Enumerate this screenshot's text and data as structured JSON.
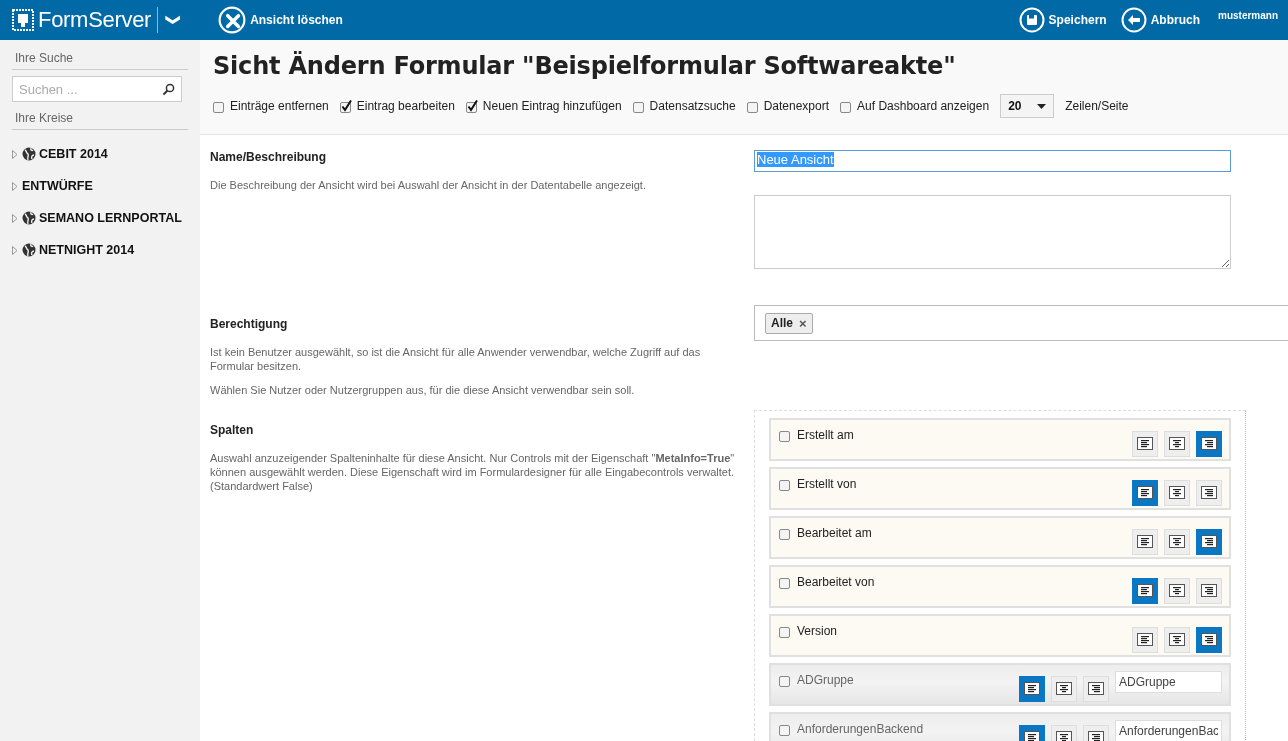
{
  "topbar": {
    "logo": "FormServer",
    "caret": "❯",
    "actions": [
      {
        "kind": "delete",
        "label": "Ansicht löschen"
      }
    ],
    "right_actions": [
      {
        "kind": "save",
        "label": "Speichern"
      },
      {
        "kind": "cancel",
        "label": "Abbruch"
      }
    ],
    "user": "mustermann"
  },
  "sidebar": {
    "search_heading": "Ihre Suche",
    "search": {
      "placeholder": "Suchen ..."
    },
    "circles_heading": "Ihre Kreise",
    "items": [
      {
        "label": "CEBIT 2014",
        "kind": "public",
        "expanded": false
      },
      {
        "label": "ENTWÜRFE",
        "kind": "folder",
        "expanded": false
      },
      {
        "label": "SEMANO LERNPORTAL",
        "kind": "public",
        "expanded": false
      },
      {
        "label": "NETNIGHT 2014",
        "kind": "public",
        "expanded": false
      }
    ]
  },
  "page": {
    "title": "Sicht Ändern Formular \"Beispielformular Softwareakte\"",
    "options": [
      {
        "label": "Einträge entfernen",
        "checked": false
      },
      {
        "label": "Eintrag bearbeiten",
        "checked": true
      },
      {
        "label": "Neuen Eintrag hinzufügen",
        "checked": true
      },
      {
        "label": "Datensatzsuche",
        "checked": false
      },
      {
        "label": "Datenexport",
        "checked": false
      },
      {
        "label": "Auf Dashboard anzeigen",
        "checked": false
      }
    ],
    "rows_per_page": {
      "value": "20",
      "label": "Zeilen/Seite"
    }
  },
  "sections": [
    {
      "kind": "name",
      "heading": "Name/Beschreibung",
      "texts": [
        "Die Beschreibung der Ansicht wird bei Auswahl der Ansicht in der Datentabelle angezeigt."
      ],
      "name_value": "Neue Ansicht"
    },
    {
      "kind": "permission",
      "heading": "Berechtigung",
      "texts": [
        "Ist kein Benutzer ausgewählt, so ist die Ansicht für alle Anwender verwendbar, welche Zugriff auf das Formular besitzen.",
        "Wählen Sie Nutzer oder Nutzergruppen aus, für die diese Ansicht verwendbar sein soll."
      ],
      "tags": [
        {
          "label": "Alle",
          "remove": "×"
        }
      ]
    },
    {
      "kind": "columns",
      "heading": "Spalten",
      "texts": [
        "Auswahl anzuzeigender Spalteninhalte für diese Ansicht. Nur Controls mit der Eigenschaft \"**MetaInfo=True**\" können ausgewählt werden. Diese Eigenschaft wird im Formulardesigner für alle Eingabecontrols verwaltet. (Standardwert False)"
      ],
      "columns": [
        {
          "kind": "meta",
          "label": "Erstellt am",
          "checked": false,
          "alignments": [
            {
              "kind": "left",
              "selected": false
            },
            {
              "kind": "center",
              "selected": false
            },
            {
              "kind": "right",
              "selected": true
            }
          ]
        },
        {
          "kind": "meta",
          "label": "Erstellt von",
          "checked": false,
          "alignments": [
            {
              "kind": "left",
              "selected": true
            },
            {
              "kind": "center",
              "selected": false
            },
            {
              "kind": "right",
              "selected": false
            }
          ]
        },
        {
          "kind": "meta",
          "label": "Bearbeitet am",
          "checked": false,
          "alignments": [
            {
              "kind": "left",
              "selected": false
            },
            {
              "kind": "center",
              "selected": false
            },
            {
              "kind": "right",
              "selected": true
            }
          ]
        },
        {
          "kind": "meta",
          "label": "Bearbeitet von",
          "checked": false,
          "alignments": [
            {
              "kind": "left",
              "selected": true
            },
            {
              "kind": "center",
              "selected": false
            },
            {
              "kind": "right",
              "selected": false
            }
          ]
        },
        {
          "kind": "meta",
          "label": "Version",
          "checked": false,
          "alignments": [
            {
              "kind": "left",
              "selected": false
            },
            {
              "kind": "center",
              "selected": false
            },
            {
              "kind": "right",
              "selected": true
            }
          ]
        },
        {
          "kind": "field",
          "label": "ADGruppe",
          "checked": false,
          "caption": "ADGruppe",
          "alignments": [
            {
              "kind": "left",
              "selected": true
            },
            {
              "kind": "center",
              "selected": false
            },
            {
              "kind": "right",
              "selected": false
            }
          ]
        },
        {
          "kind": "field",
          "label": "AnforderungenBackend",
          "checked": false,
          "caption": "AnforderungenBac",
          "alignments": [
            {
              "kind": "left",
              "selected": true
            },
            {
              "kind": "center",
              "selected": false
            },
            {
              "kind": "right",
              "selected": false
            }
          ]
        }
      ]
    }
  ]
}
